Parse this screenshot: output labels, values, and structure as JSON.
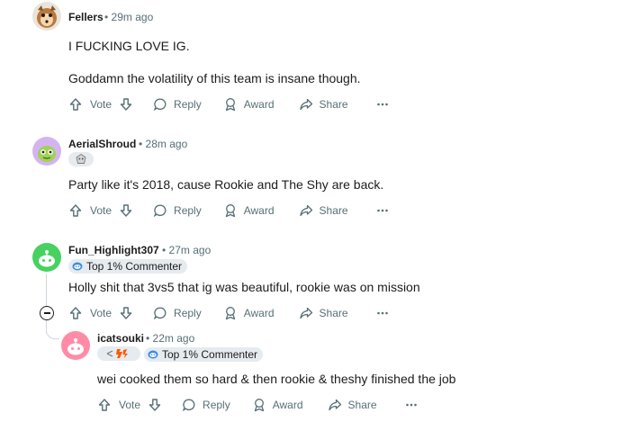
{
  "comments": [
    {
      "username": "Fellers",
      "time": "29m ago",
      "lines": [
        "I FUCKING LOVE IG.",
        "Goddamn the volatility of this team is insane though."
      ],
      "actions": {
        "vote": "Vote",
        "reply": "Reply",
        "award": "Award",
        "share": "Share"
      }
    },
    {
      "username": "AerialShroud",
      "time": "28m ago",
      "flair_icon": "skull-flair-icon",
      "lines": [
        "Party like it's 2018, cause Rookie and The Shy are back."
      ],
      "actions": {
        "vote": "Vote",
        "reply": "Reply",
        "award": "Award",
        "share": "Share"
      }
    },
    {
      "username": "Fun_Highlight307",
      "time": "27m ago",
      "badge": "Top 1% Commenter",
      "lines": [
        "Holly shit that 3vs5 that ig was beautiful, rookie was on mission"
      ],
      "actions": {
        "vote": "Vote",
        "reply": "Reply",
        "award": "Award",
        "share": "Share"
      }
    },
    {
      "username": "icatsouki",
      "time": "22m ago",
      "flair_icon": "fnatic-flair-icon",
      "badge": "Top 1% Commenter",
      "lines": [
        "wei cooked them so hard & then rookie & theshy finished the job"
      ],
      "actions": {
        "vote": "Vote",
        "reply": "Reply",
        "award": "Award",
        "share": "Share"
      }
    }
  ],
  "colors": {
    "meta": "#576f76",
    "badge_bg": "#e5ebee",
    "snoo_green": "#46d160",
    "snoo_pink": "#ff8ba7"
  },
  "separator": "•"
}
